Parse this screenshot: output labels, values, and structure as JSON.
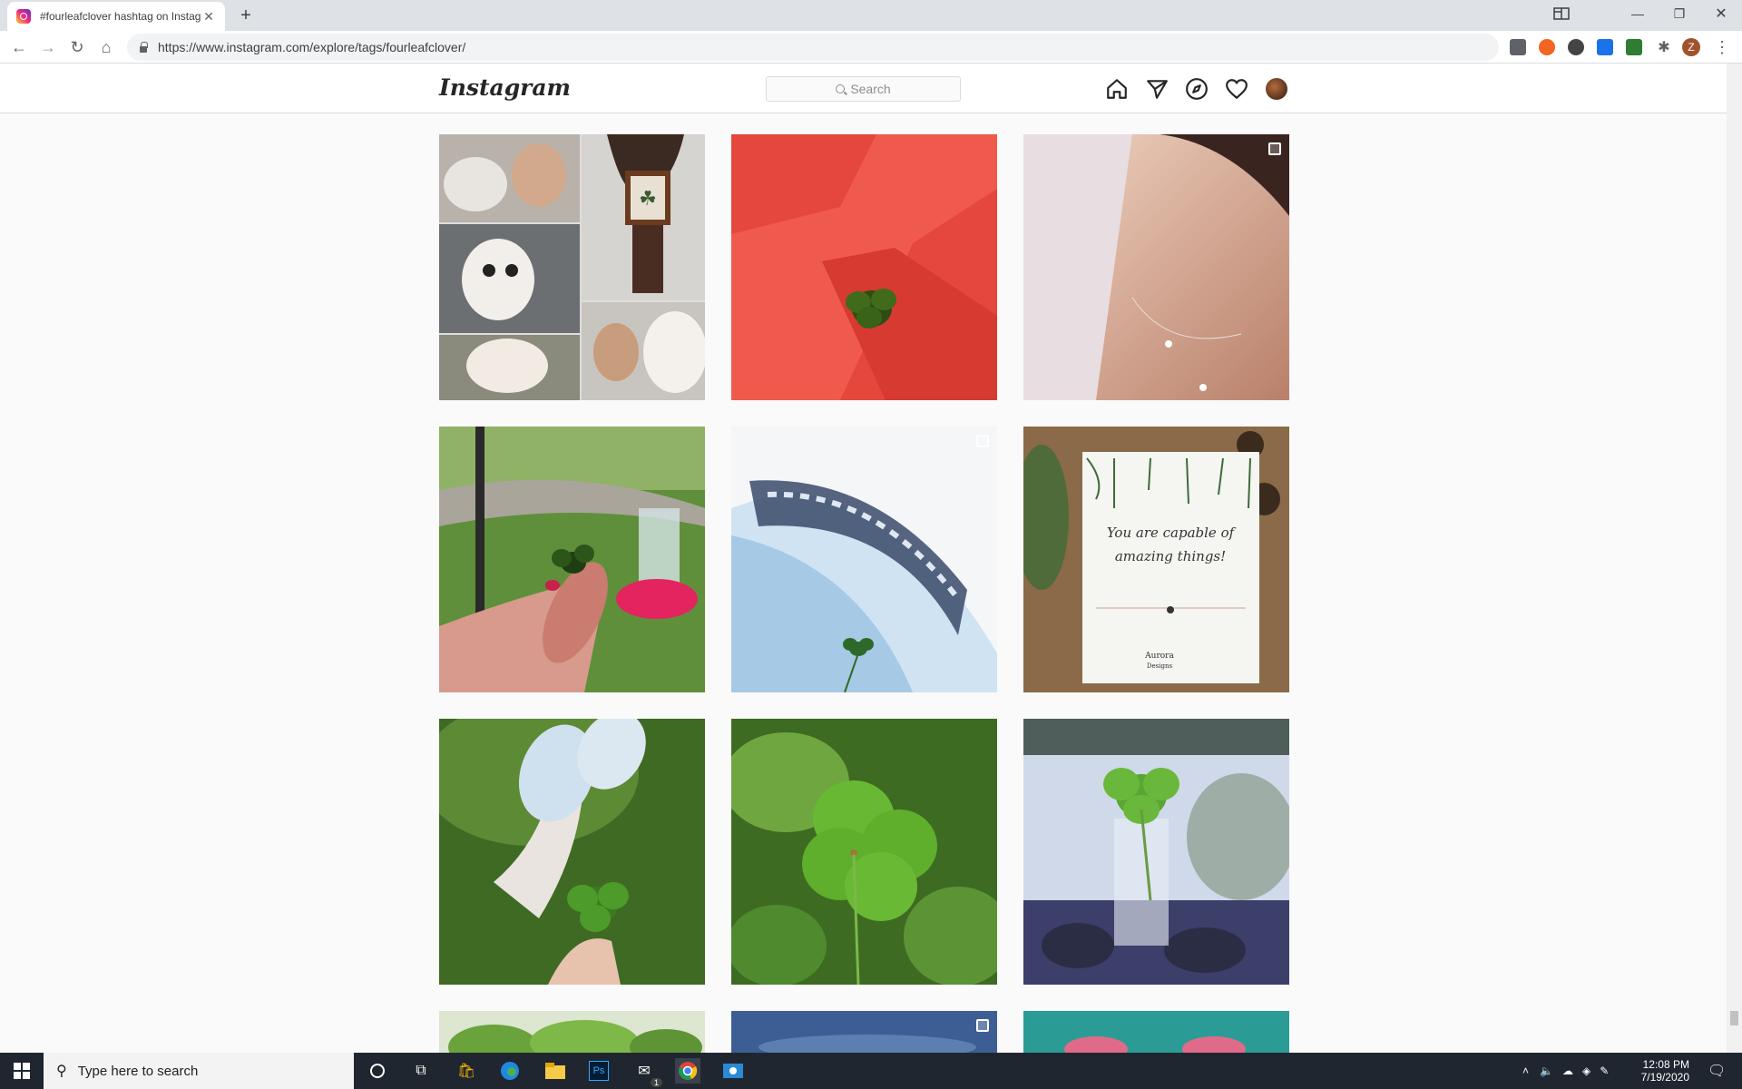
{
  "browser": {
    "tab_title": "#fourleafclover hashtag on Instag",
    "url": "https://www.instagram.com/explore/tags/fourleafclover/",
    "profile_initial": "Z"
  },
  "instagram": {
    "logo": "Instagram",
    "search_placeholder": "Search"
  },
  "tiles": [
    {
      "desc": "collage-dogs-man-clover-plaque",
      "multi": false
    },
    {
      "desc": "clover-on-red-surface",
      "multi": false
    },
    {
      "desc": "woman-necklace",
      "multi": true
    },
    {
      "desc": "hand-holding-clover-garden",
      "multi": false
    },
    {
      "desc": "clover-blue-pattern-fabric",
      "multi": true
    },
    {
      "desc": "card-you-are-capable",
      "multi": false
    },
    {
      "desc": "sneakers-clover-grass",
      "multi": false
    },
    {
      "desc": "clover-closeup-leaves",
      "multi": false
    },
    {
      "desc": "clover-in-shot-glass",
      "multi": false
    },
    {
      "desc": "green-plant",
      "multi": false
    },
    {
      "desc": "blue-sky",
      "multi": true
    },
    {
      "desc": "teal-flowers",
      "multi": false
    }
  ],
  "card_text": "You are capable of amazing things!",
  "card_brand": "Aurora Designs",
  "taskbar": {
    "search_placeholder": "Type here to search",
    "time": "12:08 PM",
    "date": "7/19/2020",
    "mail_badge": "1"
  },
  "colors": {
    "instagram_bg": "#fafafa",
    "taskbar": "#202630",
    "tab_strip": "#dee1e6"
  }
}
